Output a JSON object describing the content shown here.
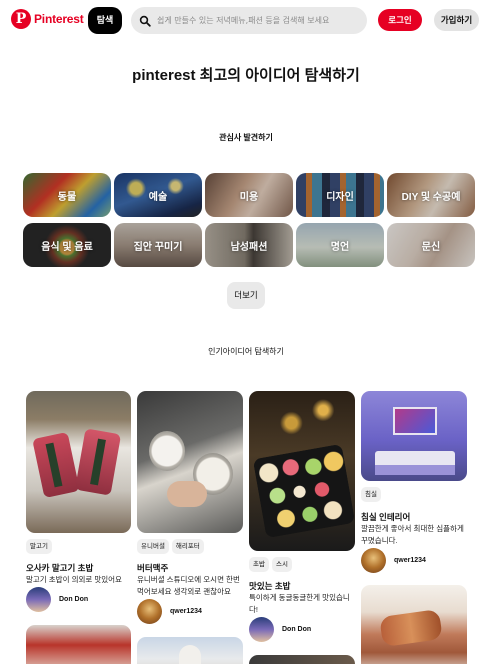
{
  "header": {
    "logo_text": "Pinterest",
    "explore_label": "탐색",
    "search_placeholder": "쉽게 만들수 있는 저녁메뉴,패션 등을 검색해 보세요",
    "login_label": "로그인",
    "signup_label": "가입하기"
  },
  "colors": {
    "brand": "#e60023",
    "explore_bg": "#000000",
    "chip_bg": "#e9e9e9"
  },
  "page_title": "pinterest 최고의 아이디어 탐색하기",
  "discover_title": "관심사 발견하기",
  "categories": [
    {
      "label": "동물"
    },
    {
      "label": "예술"
    },
    {
      "label": "미용"
    },
    {
      "label": "디자인"
    },
    {
      "label": "DIY 및 수공예"
    },
    {
      "label": "음식 및 음료"
    },
    {
      "label": "집안 꾸미기"
    },
    {
      "label": "남성패션"
    },
    {
      "label": "명언"
    },
    {
      "label": "문신"
    }
  ],
  "more_label": "더보기",
  "popular_title": "인기아이디어 탐색하기",
  "pins": [
    {
      "tags": [
        "말고기"
      ],
      "title": "오사카 말고기 초밥",
      "desc": "말고기 초밥이 의외로 맛있어요",
      "author": "Don Don"
    },
    {
      "tags": [
        "유니버셜",
        "해리포터"
      ],
      "title": "버터맥주",
      "desc": "유니버셜 스튜디오에 오시면 한번 먹어보세요 생각외로 괜찮아요",
      "author": "qwer1234"
    },
    {
      "tags": [
        "초밥",
        "스시"
      ],
      "title": "맛있는 초밥",
      "desc": "특이하게 동글동글한게 맛있습니다!",
      "author": "Don Don"
    },
    {
      "tags": [
        "침실"
      ],
      "title": "침실 인테리어",
      "desc": "깔끔한게 좋아서 최대한 심플하게 꾸몄습니다.",
      "author": "qwer1234"
    }
  ]
}
